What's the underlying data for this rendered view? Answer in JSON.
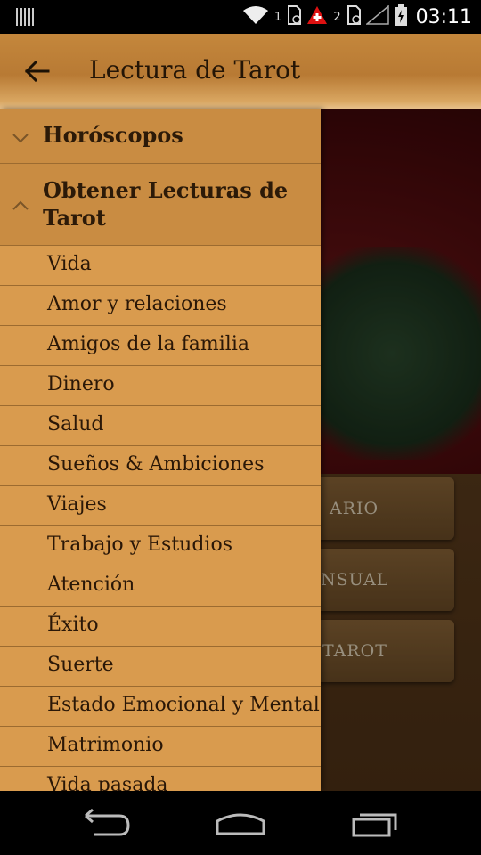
{
  "status_bar": {
    "sim1_label": "1",
    "sim2_label": "2",
    "time": "03:11"
  },
  "app_bar": {
    "title": "Lectura de Tarot",
    "back_icon": "arrow-left-icon"
  },
  "background": {
    "buttons": [
      {
        "label": "ARIO"
      },
      {
        "label": "NSUAL"
      },
      {
        "label": "TAROT"
      }
    ]
  },
  "drawer": {
    "groups": [
      {
        "label": "Horóscopos",
        "expanded": false
      },
      {
        "label": "Obtener Lecturas de Tarot",
        "expanded": true
      }
    ],
    "items": [
      {
        "label": "Vida"
      },
      {
        "label": "Amor y relaciones"
      },
      {
        "label": "Amigos de la familia"
      },
      {
        "label": "Dinero"
      },
      {
        "label": "Salud"
      },
      {
        "label": "Sueños & Ambiciones"
      },
      {
        "label": "Viajes"
      },
      {
        "label": "Trabajo y Estudios"
      },
      {
        "label": "Atención"
      },
      {
        "label": "Éxito"
      },
      {
        "label": "Suerte"
      },
      {
        "label": "Estado Emocional y Mental"
      },
      {
        "label": "Matrimonio"
      },
      {
        "label": "Vida pasada"
      }
    ]
  },
  "colors": {
    "drawer_bg": "#d89a4d",
    "group_header_bg": "#c98c42",
    "app_bar": "#c4873c",
    "text": "#2a1707"
  }
}
